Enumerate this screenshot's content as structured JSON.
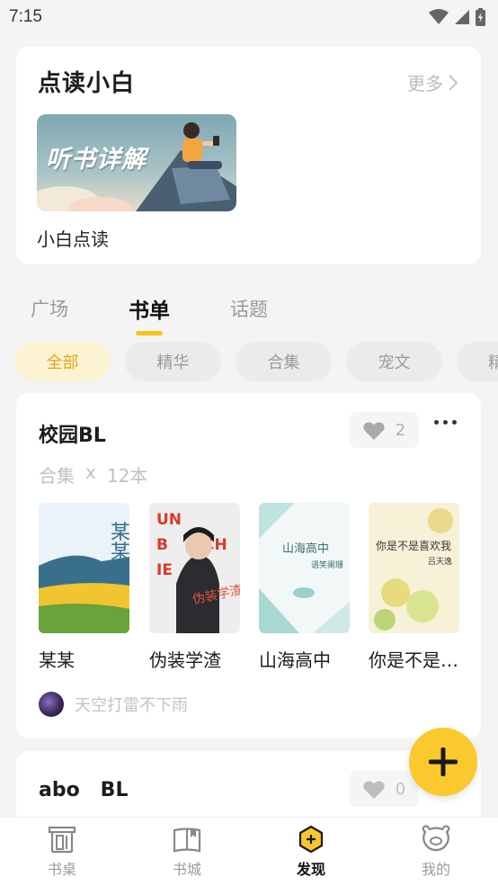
{
  "status_bar": {
    "time": "7:15"
  },
  "recommend": {
    "title": "点读小白",
    "more_label": "更多",
    "banner_text": "听书详解",
    "caption": "小白点读"
  },
  "tabs": [
    {
      "label": "广场",
      "active": false
    },
    {
      "label": "书单",
      "active": true
    },
    {
      "label": "话题",
      "active": false
    }
  ],
  "chips": [
    {
      "label": "全部",
      "active": true
    },
    {
      "label": "精华",
      "active": false
    },
    {
      "label": "合集",
      "active": false
    },
    {
      "label": "宠文",
      "active": false
    },
    {
      "label": "精",
      "active": false
    }
  ],
  "booklists": [
    {
      "title": "校园BL",
      "likes": "2",
      "type": "合集",
      "multiplier": "x",
      "count": "12本",
      "books": [
        {
          "name": "某某"
        },
        {
          "name": "伪装学渣"
        },
        {
          "name": "山海高中"
        },
        {
          "name": "你是不是…"
        }
      ],
      "author": "天空打雷不下雨"
    },
    {
      "title": "abo   BL",
      "likes": "0"
    }
  ],
  "nav": [
    {
      "label": "书桌",
      "icon": "desk-icon",
      "active": false
    },
    {
      "label": "书城",
      "icon": "book-icon",
      "active": false
    },
    {
      "label": "发现",
      "icon": "discover-icon",
      "active": true
    },
    {
      "label": "我的",
      "icon": "profile-icon",
      "active": false
    }
  ],
  "colors": {
    "accent": "#f5c518",
    "fab": "#f9c92e",
    "chip_active_bg": "#fcf3d3",
    "chip_active_text": "#e3a51e"
  }
}
